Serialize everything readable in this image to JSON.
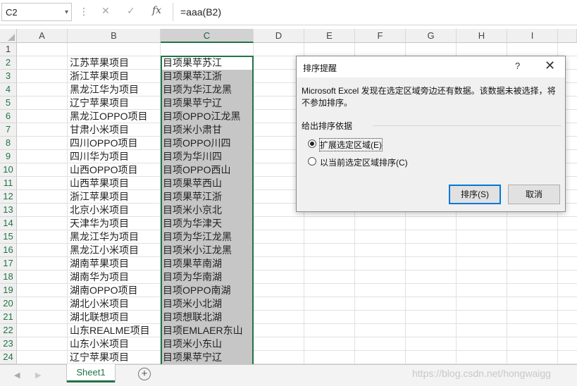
{
  "formula_bar": {
    "name_box": "C2",
    "cancel_icon": "✕",
    "enter_icon": "✓",
    "fx_label": "fx",
    "formula": "=aaa(B2)"
  },
  "columns": [
    "A",
    "B",
    "C",
    "D",
    "E",
    "F",
    "G",
    "H",
    "I"
  ],
  "rows": [
    "1",
    "2",
    "3",
    "4",
    "5",
    "6",
    "7",
    "8",
    "9",
    "10",
    "11",
    "12",
    "13",
    "14",
    "15",
    "16",
    "17",
    "18",
    "19",
    "20",
    "21",
    "22",
    "23",
    "24"
  ],
  "column_b": [
    "",
    "江苏苹果项目",
    "浙江苹果项目",
    "黑龙江华为项目",
    "辽宁苹果项目",
    "黑龙江OPPO项目",
    "甘肃小米项目",
    "四川OPPO项目",
    "四川华为项目",
    "山西OPPO项目",
    "山西苹果项目",
    "浙江苹果项目",
    "北京小米项目",
    "天津华为项目",
    "黑龙江华为项目",
    "黑龙江小米项目",
    "湖南苹果项目",
    "湖南华为项目",
    "湖南OPPO项目",
    "湖北小米项目",
    "湖北联想项目",
    "山东REALME项目",
    "山东小米项目",
    "辽宁苹果项目"
  ],
  "column_c": [
    "",
    "目项果苹苏江",
    "目项果苹江浙",
    "目项为华江龙黑",
    "目项果苹宁辽",
    "目项OPPO江龙黑",
    "目项米小肃甘",
    "目项OPPO川四",
    "目项为华川四",
    "目项OPPO西山",
    "目项果苹西山",
    "目项果苹江浙",
    "目项米小京北",
    "目项为华津天",
    "目项为华江龙黑",
    "目项米小江龙黑",
    "目项果苹南湖",
    "目项为华南湖",
    "目项OPPO南湖",
    "目项米小北湖",
    "目项想联北湖",
    "目项EMLAER东山",
    "目项米小东山",
    "目项果苹宁辽"
  ],
  "dialog": {
    "title": "排序提醒",
    "help": "?",
    "close": "✕",
    "message": "Microsoft Excel 发现在选定区域旁边还有数据。该数据未被选择，将不参加排序。",
    "group_label": "给出排序依据",
    "options": [
      {
        "label": "扩展选定区域(E)",
        "selected": true
      },
      {
        "label": "以当前选定区域排序(C)",
        "selected": false
      }
    ],
    "sort_button": "排序(S)",
    "cancel_button": "取消"
  },
  "sheet_tabs": {
    "prev": "◀",
    "next": "▶",
    "active_tab": "Sheet1",
    "add": "+"
  },
  "watermark": "https://blog.csdn.net/hongwaigg",
  "colors": {
    "accent": "#217346",
    "selection_fill": "#c6c6c6",
    "primary_button_border": "#0078d7"
  }
}
